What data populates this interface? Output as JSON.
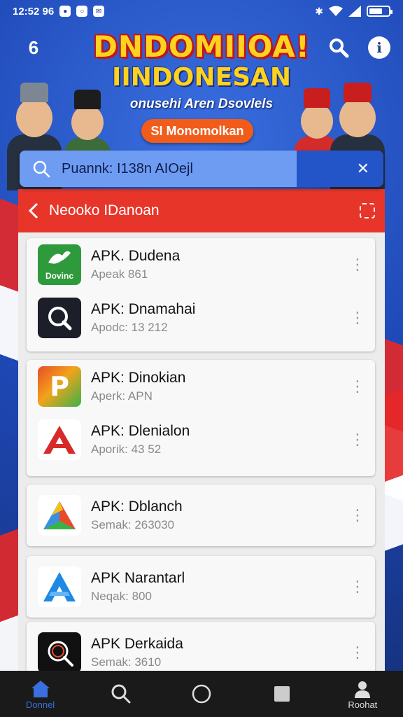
{
  "status_bar": {
    "time": "12:52 96",
    "icons": [
      "notification-icon",
      "circle-app-icon",
      "mail-icon"
    ],
    "right_icons": [
      "bluetooth-icon",
      "wifi-icon",
      "signal-icon",
      "battery-icon"
    ]
  },
  "banner": {
    "title": "DNDOMIIOA!",
    "subtitle": "IINDONESAN",
    "tagline": "onusehi Aren Dsovlels",
    "cta_label": "SI Monomolkan"
  },
  "search": {
    "placeholder": "Puannk: I138n AIOejl"
  },
  "panel": {
    "title": "Neooko IDanoan"
  },
  "apps": [
    {
      "name": "APK. Dudena",
      "sub": "Apeak 861",
      "icon": "dove-icon",
      "icon_text": "Dovinc",
      "icon_color": "#2e9a3c"
    },
    {
      "name": "APK: Dnamahai",
      "sub": "Apodc: 13 212",
      "icon": "search-lens-icon",
      "icon_color": "#1c1f2a"
    },
    {
      "name": "APK: Dinokian",
      "sub": "Aperk: APN",
      "icon": "play-p-icon",
      "icon_color": "#f2a31a"
    },
    {
      "name": "APK: Dlenialon",
      "sub": "Aporik: 43 52",
      "icon": "red-a-icon",
      "icon_color": "#d72b2b"
    },
    {
      "name": "APK: Dblanch",
      "sub": "Semak: 263030",
      "icon": "colorful-triangle-icon",
      "icon_color": "#3a8fe0"
    },
    {
      "name": "APK Narantarl",
      "sub": "Neqak: 800",
      "icon": "blue-a-icon",
      "icon_color": "#1e88e5"
    },
    {
      "name": "APK Derkaida",
      "sub": "Semak: 3610",
      "icon": "dark-lens-icon",
      "icon_color": "#111111"
    }
  ],
  "nav": {
    "home_label": "Donnel",
    "profile_label": "Roohat"
  },
  "colors": {
    "accent_red": "#e8352a",
    "accent_blue": "#3a6fe0",
    "banner_yellow": "#ffd21f"
  }
}
